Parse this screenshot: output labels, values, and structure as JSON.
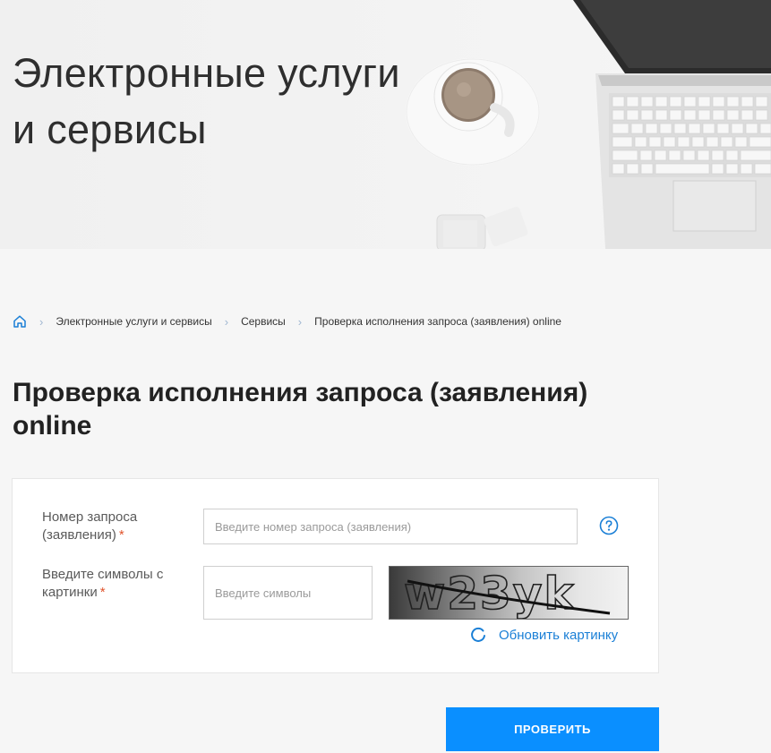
{
  "hero": {
    "title_line1": "Электронные услуги",
    "title_line2": "и сервисы"
  },
  "breadcrumb": {
    "home_icon": "home-icon",
    "items": [
      "Электронные услуги и сервисы",
      "Сервисы",
      "Проверка исполнения запроса (заявления) online"
    ]
  },
  "page": {
    "title": "Проверка исполнения запроса (заявления) online"
  },
  "form": {
    "request_label_line1": "Номер запроса",
    "request_label_line2": "(заявления)",
    "request_placeholder": "Введите номер запроса (заявления)",
    "request_value": "",
    "help_icon": "question-circle-icon",
    "captcha_label_line1": "Введите символы с",
    "captcha_label_line2": "картинки",
    "captcha_placeholder": "Введите символы",
    "captcha_value": "",
    "captcha_text": "w23yk",
    "required_mark": "*",
    "refresh_label": "Обновить картинку",
    "refresh_icon": "refresh-icon",
    "submit_label": "ПРОВЕРИТЬ"
  },
  "colors": {
    "accent": "#0a8fff",
    "link": "#1a7fd6",
    "required": "#e0532b"
  }
}
